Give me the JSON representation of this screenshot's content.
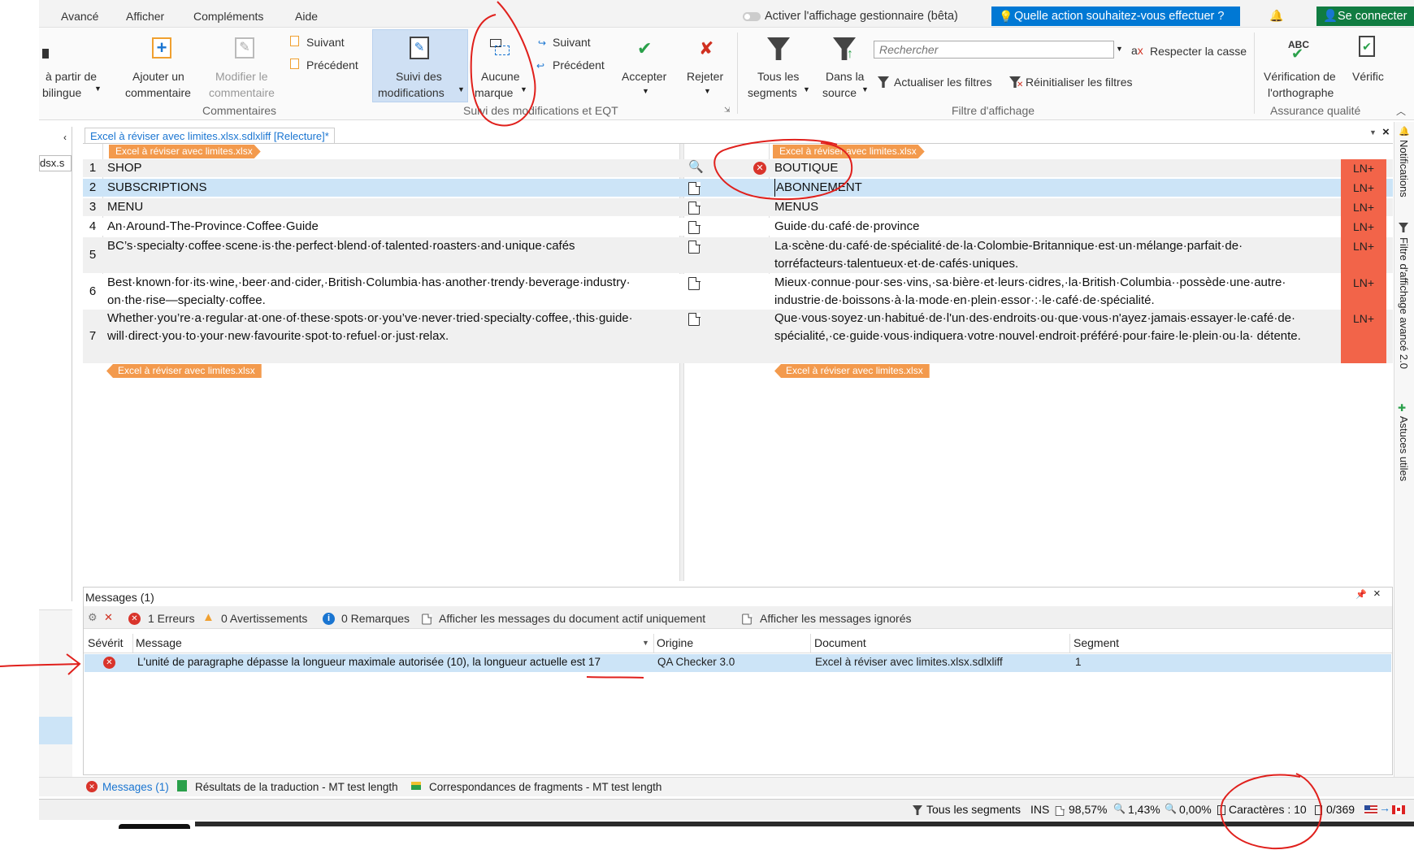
{
  "menu": {
    "items": [
      "Avancé",
      "Afficher",
      "Compléments",
      "Aide"
    ]
  },
  "topbar": {
    "toggle_label": "Activer l'affichage gestionnaire (bêta)",
    "tell_me": "Quelle action souhaitez-vous effectuer ?",
    "signin": "Se connecter"
  },
  "ribbon": {
    "bilingual": {
      "line1": "à partir de",
      "line2": "bilingue"
    },
    "add_comment": {
      "line1": "Ajouter un",
      "line2": "commentaire"
    },
    "edit_comment": {
      "line1": "Modifier le",
      "line2": "commentaire"
    },
    "next1": "Suivant",
    "prev1": "Précédent",
    "comments_group": "Commentaires",
    "track": {
      "line1": "Suivi des",
      "line2": "modifications"
    },
    "markup": {
      "line1": "Aucune",
      "line2": "marque"
    },
    "next2": "Suivant",
    "prev2": "Précédent",
    "accept": "Accepter",
    "reject": "Rejeter",
    "track_group": "Suivi des modifications et EQT",
    "all_segments": {
      "line1": "Tous les",
      "line2": "segments"
    },
    "in_source": {
      "line1": "Dans la",
      "line2": "source"
    },
    "search_placeholder": "Rechercher",
    "match_case": "Respecter la casse",
    "update_filters": "Actualiser les filtres",
    "reset_filters": "Réinitialiser les filtres",
    "filter_group": "Filtre d'affichage",
    "spell": {
      "line1": "Vérification de",
      "line2": "l'orthographe"
    },
    "verify": "Vérific",
    "qa_group": "Assurance qualité"
  },
  "leftpane": {
    "item": "dsx.s"
  },
  "editor": {
    "tab": "Excel à réviser avec limites.xlsx.sdlxliff [Relecture]*",
    "file_tag": "Excel à réviser avec limites.xlsx",
    "rows": [
      {
        "num": "1",
        "src": "SHOP",
        "tgt": "BOUTIQUE",
        "status": "LN+"
      },
      {
        "num": "2",
        "src": "SUBSCRIPTIONS",
        "tgt": "ABONNEMENT",
        "status": "LN+"
      },
      {
        "num": "3",
        "src": "MENU",
        "tgt": "MENUS",
        "status": "LN+"
      },
      {
        "num": "4",
        "src": "An·Around-The-Province·Coffee·Guide",
        "tgt": "Guide·du·café·de·province",
        "status": "LN+"
      },
      {
        "num": "5",
        "src": "BC’s·specialty·coffee·scene·is·the·perfect·blend·of·talented·roasters·and·unique·cafés",
        "tgt": "La·scène·du·café·de·spécialité·de·la·Colombie-Britannique·est·un·mélange·parfait·de· torréfacteurs·talentueux·et·de·cafés·uniques.",
        "status": "LN+"
      },
      {
        "num": "6",
        "src": "Best·known·for·its·wine,·beer·and·cider,·British·Columbia·has·another·trendy·beverage·industry· on·the·rise—specialty·coffee.",
        "tgt": "Mieux·connue·pour·ses·vins,·sa·bière·et·leurs·cidres,·la·British·Columbia··possède·une·autre· industrie·de·boissons·à·la·mode·en·plein·essor·:·le·café·de·spécialité.",
        "status": "LN+"
      },
      {
        "num": "7",
        "src": "Whether·you’re·a·regular·at·one·of·these·spots·or·you’ve·never·tried·specialty·coffee,·this·guide· will·direct·you·to·your·new·favourite·spot·to·refuel·or·just·relax.",
        "tgt": "Que·vous·soyez·un·habitué·de·l'un·des·endroits·ou·que·vous·n'ayez·jamais·essayer·le·café·de· spécialité,·ce·guide·vous·indiquera·votre·nouvel·endroit·préféré·pour·faire·le·plein·ou·la· détente.",
        "status": "LN+"
      }
    ]
  },
  "side": {
    "notifications": "Notifications",
    "advanced_filter": "Filtre d'affichage avancé 2.0",
    "tips": "Astuces utiles"
  },
  "messages": {
    "title": "Messages (1)",
    "errors": "1 Erreurs",
    "warnings": "0 Avertissements",
    "notes": "0 Remarques",
    "active_only": "Afficher les messages du document actif uniquement",
    "ignored": "Afficher les messages ignorés",
    "columns": [
      "Sévérit",
      "Message",
      "Origine",
      "Document",
      "Segment"
    ],
    "row": {
      "message": "L'unité de paragraphe dépasse la longueur maximale autorisée (10), la longueur actuelle est 17",
      "origin": "QA Checker 3.0",
      "document": "Excel à réviser avec limites.xlsx.sdlxliff",
      "segment": "1"
    }
  },
  "bottom_tabs": [
    "Messages (1)",
    "Résultats de la traduction - MT test length",
    "Correspondances de fragments - MT test length"
  ],
  "statusbar": {
    "filter": "Tous les segments",
    "ins": "INS",
    "p1": "98,57%",
    "p2": "1,43%",
    "p3": "0,00%",
    "chars": "Caractères : 10",
    "count": "0/369"
  },
  "colors": {
    "accent": "#0078d4",
    "tag_orange": "#f39a4d",
    "status_red": "#f26449",
    "selection": "#cce4f7",
    "green": "#107c41",
    "annotation": "#e0201c"
  }
}
